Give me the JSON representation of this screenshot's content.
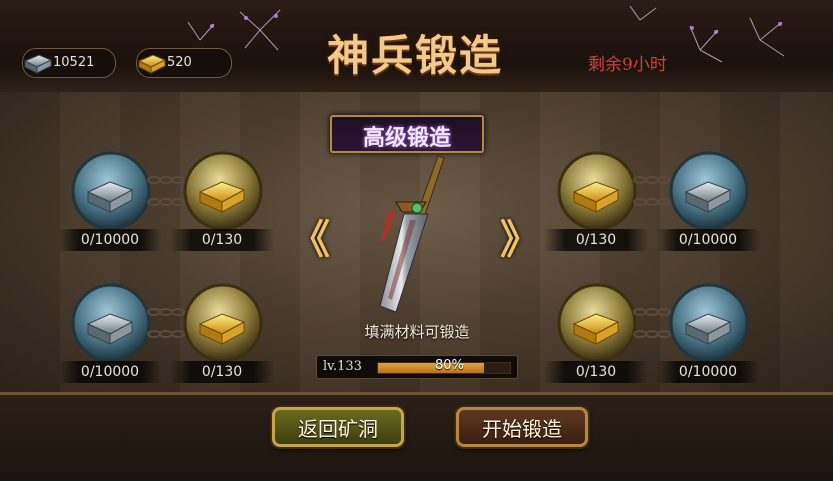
{
  "header": {
    "title": "神兵锻造",
    "time_remaining": "剩余9小时",
    "resources": [
      {
        "icon": "silver-ingot-icon",
        "value": "10521"
      },
      {
        "icon": "gold-ingot-icon",
        "value": "520"
      }
    ]
  },
  "forge": {
    "subtitle": "高级锻造",
    "prev_arrow": "《",
    "next_arrow": "》",
    "hint": "填满材料可锻造",
    "level_label": "lv.133",
    "progress": 0.8,
    "progress_label": "80%"
  },
  "slots": [
    {
      "icon": "silver-ingot-icon",
      "count": "0/10000"
    },
    {
      "icon": "gold-ingot-icon",
      "count": "0/130"
    },
    {
      "icon": "gold-ingot-icon",
      "count": "0/130"
    },
    {
      "icon": "silver-ingot-icon",
      "count": "0/10000"
    },
    {
      "icon": "silver-ingot-icon",
      "count": "0/10000"
    },
    {
      "icon": "gold-ingot-icon",
      "count": "0/130"
    },
    {
      "icon": "gold-ingot-icon",
      "count": "0/130"
    },
    {
      "icon": "silver-ingot-icon",
      "count": "0/10000"
    }
  ],
  "buttons": {
    "return_label": "返回矿洞",
    "start_label": "开始锻造"
  },
  "colors": {
    "title": "#f2c98a",
    "time": "#d2413b",
    "progress_fill": "#e3a33a",
    "subtitle_glow": "#b36bff"
  }
}
